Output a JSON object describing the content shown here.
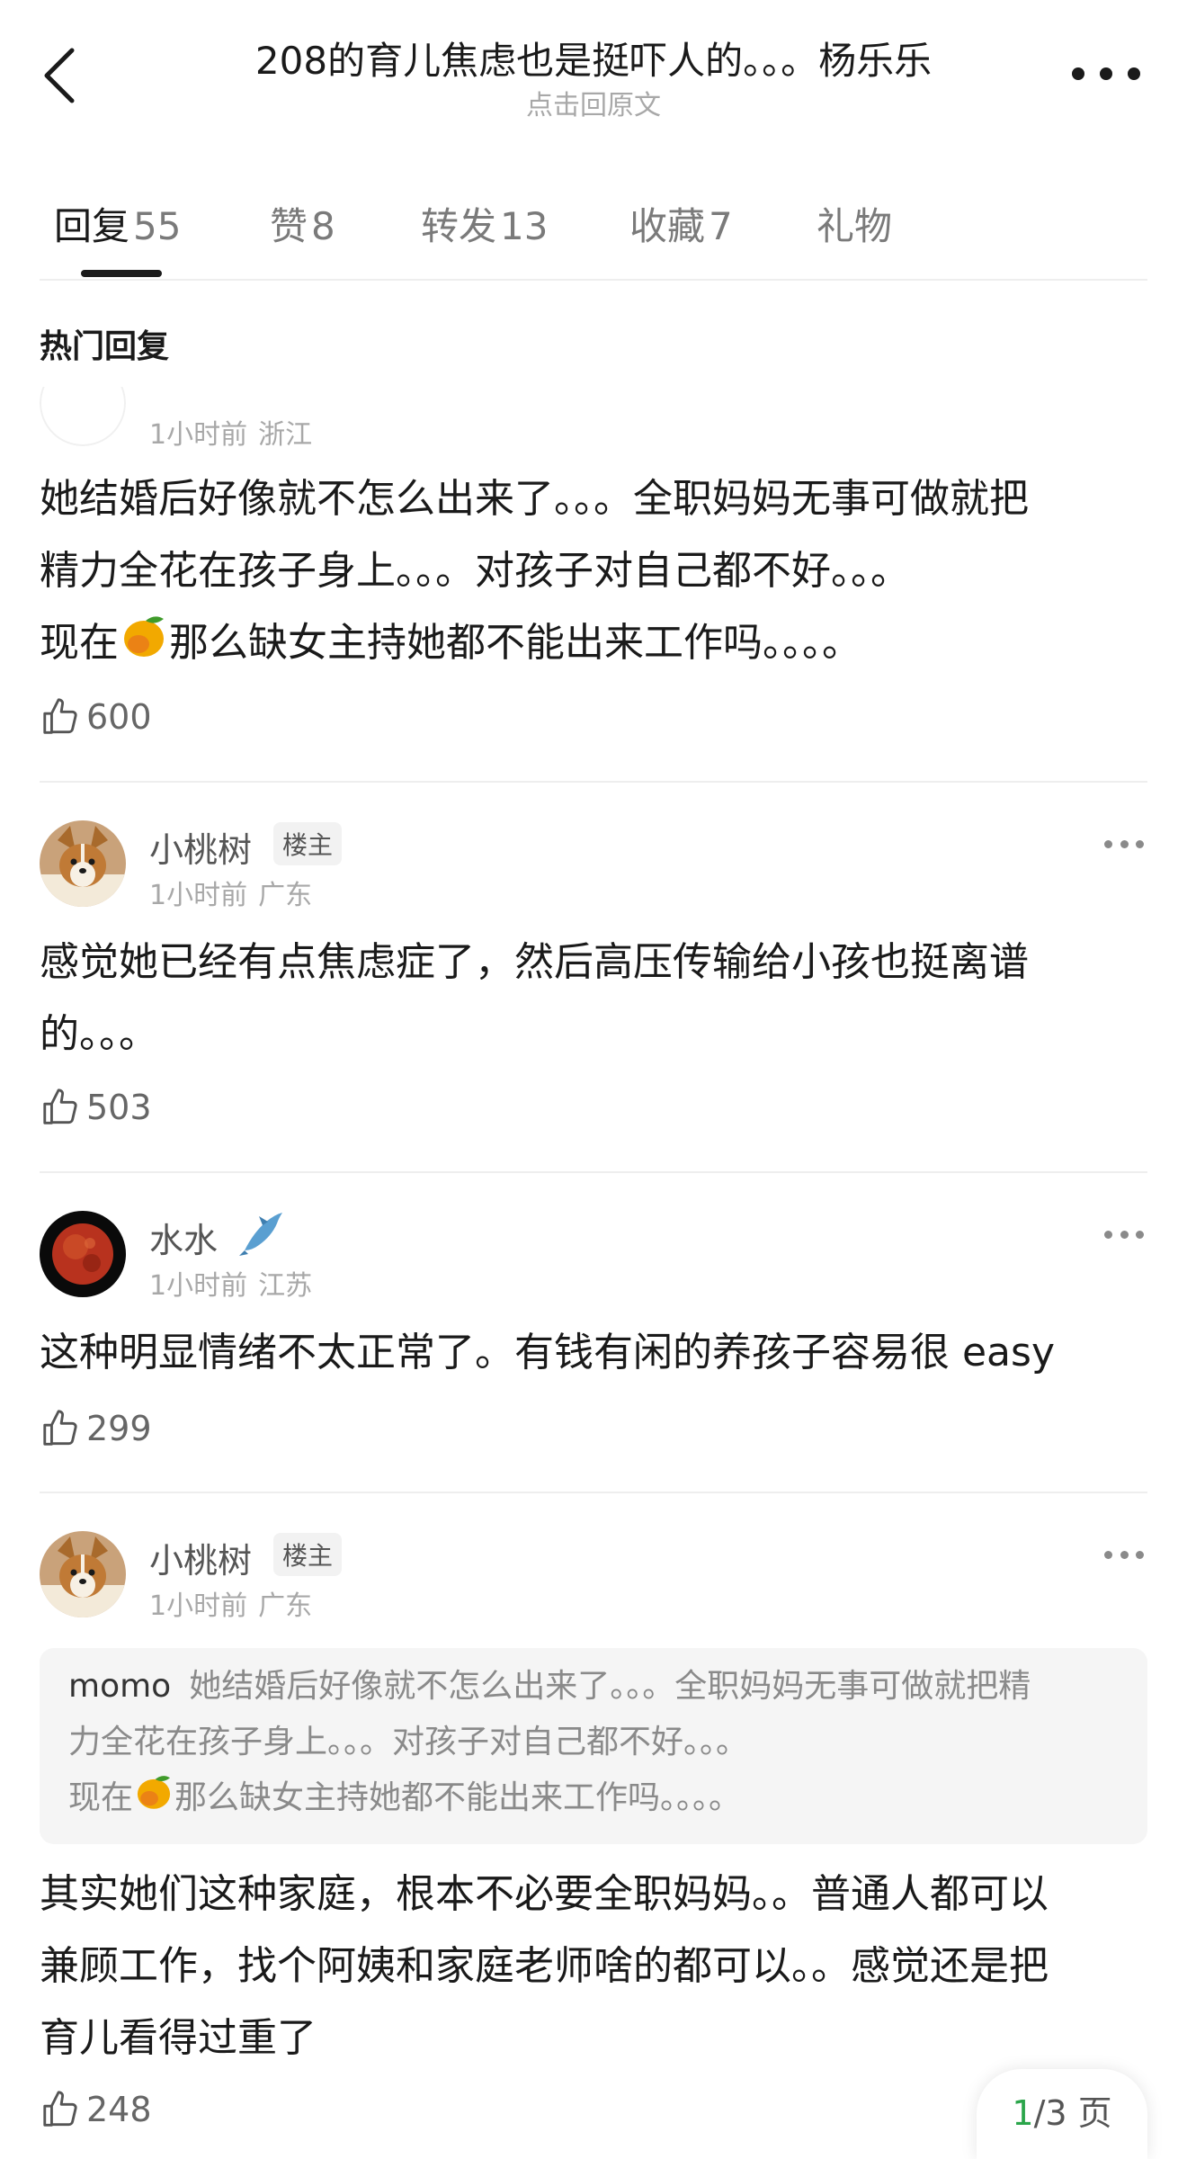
{
  "header": {
    "title": "208的育儿焦虑也是挺吓人的。。。杨乐乐",
    "subtitle": "点击回原文"
  },
  "tabs": [
    {
      "label": "回复",
      "count": "55"
    },
    {
      "label": "赞",
      "count": "8"
    },
    {
      "label": "转发",
      "count": "13"
    },
    {
      "label": "收藏",
      "count": "7"
    },
    {
      "label": "礼物",
      "count": ""
    }
  ],
  "section_title": "热门回复",
  "comments": [
    {
      "time": "1小时前",
      "location": "浙江",
      "line1": "她结婚后好像就不怎么出来了。。。全职妈妈无事可做就把",
      "line2": "精力全花在孩子身上。。。对孩子对自己都不好。。。",
      "line3_pre": "现在",
      "line3_post": "那么缺女主持她都不能出来工作吗。。。。",
      "likes": "600"
    },
    {
      "user": "小桃树",
      "badge": "楼主",
      "time": "1小时前",
      "location": "广东",
      "text": "感觉她已经有点焦虑症了，然后高压传输给小孩也挺离谱\n的。。。",
      "likes": "503"
    },
    {
      "user": "水水",
      "time": "1小时前",
      "location": "江苏",
      "text": "这种明显情绪不太正常了。有钱有闲的养孩子容易很 easy",
      "likes": "299"
    },
    {
      "user": "小桃树",
      "badge": "楼主",
      "time": "1小时前",
      "location": "广东",
      "quote_user": "momo",
      "quote_line1": "她结婚后好像就不怎么出来了。。。全职妈妈无事可做就把精",
      "quote_line2": "力全花在孩子身上。。。对孩子对自己都不好。。。",
      "quote_line3_pre": "现在",
      "quote_line3_post": "那么缺女主持她都不能出来工作吗。。。。",
      "text": "其实她们这种家庭，根本不必要全职妈妈。。普通人都可以\n兼顾工作，找个阿姨和家庭老师啥的都可以。。感觉还是把\n育儿看得过重了",
      "likes": "248"
    }
  ],
  "pager": {
    "current": "1",
    "rest": "/3 页"
  },
  "colors": {
    "accent_green": "#2aa54a",
    "text": "#1a1a1a",
    "muted": "#a8a8a8"
  },
  "icons": [
    "back-arrow-icon",
    "more-dots-icon",
    "thumbs-up-icon",
    "dolphin-icon",
    "mango-emoji"
  ]
}
